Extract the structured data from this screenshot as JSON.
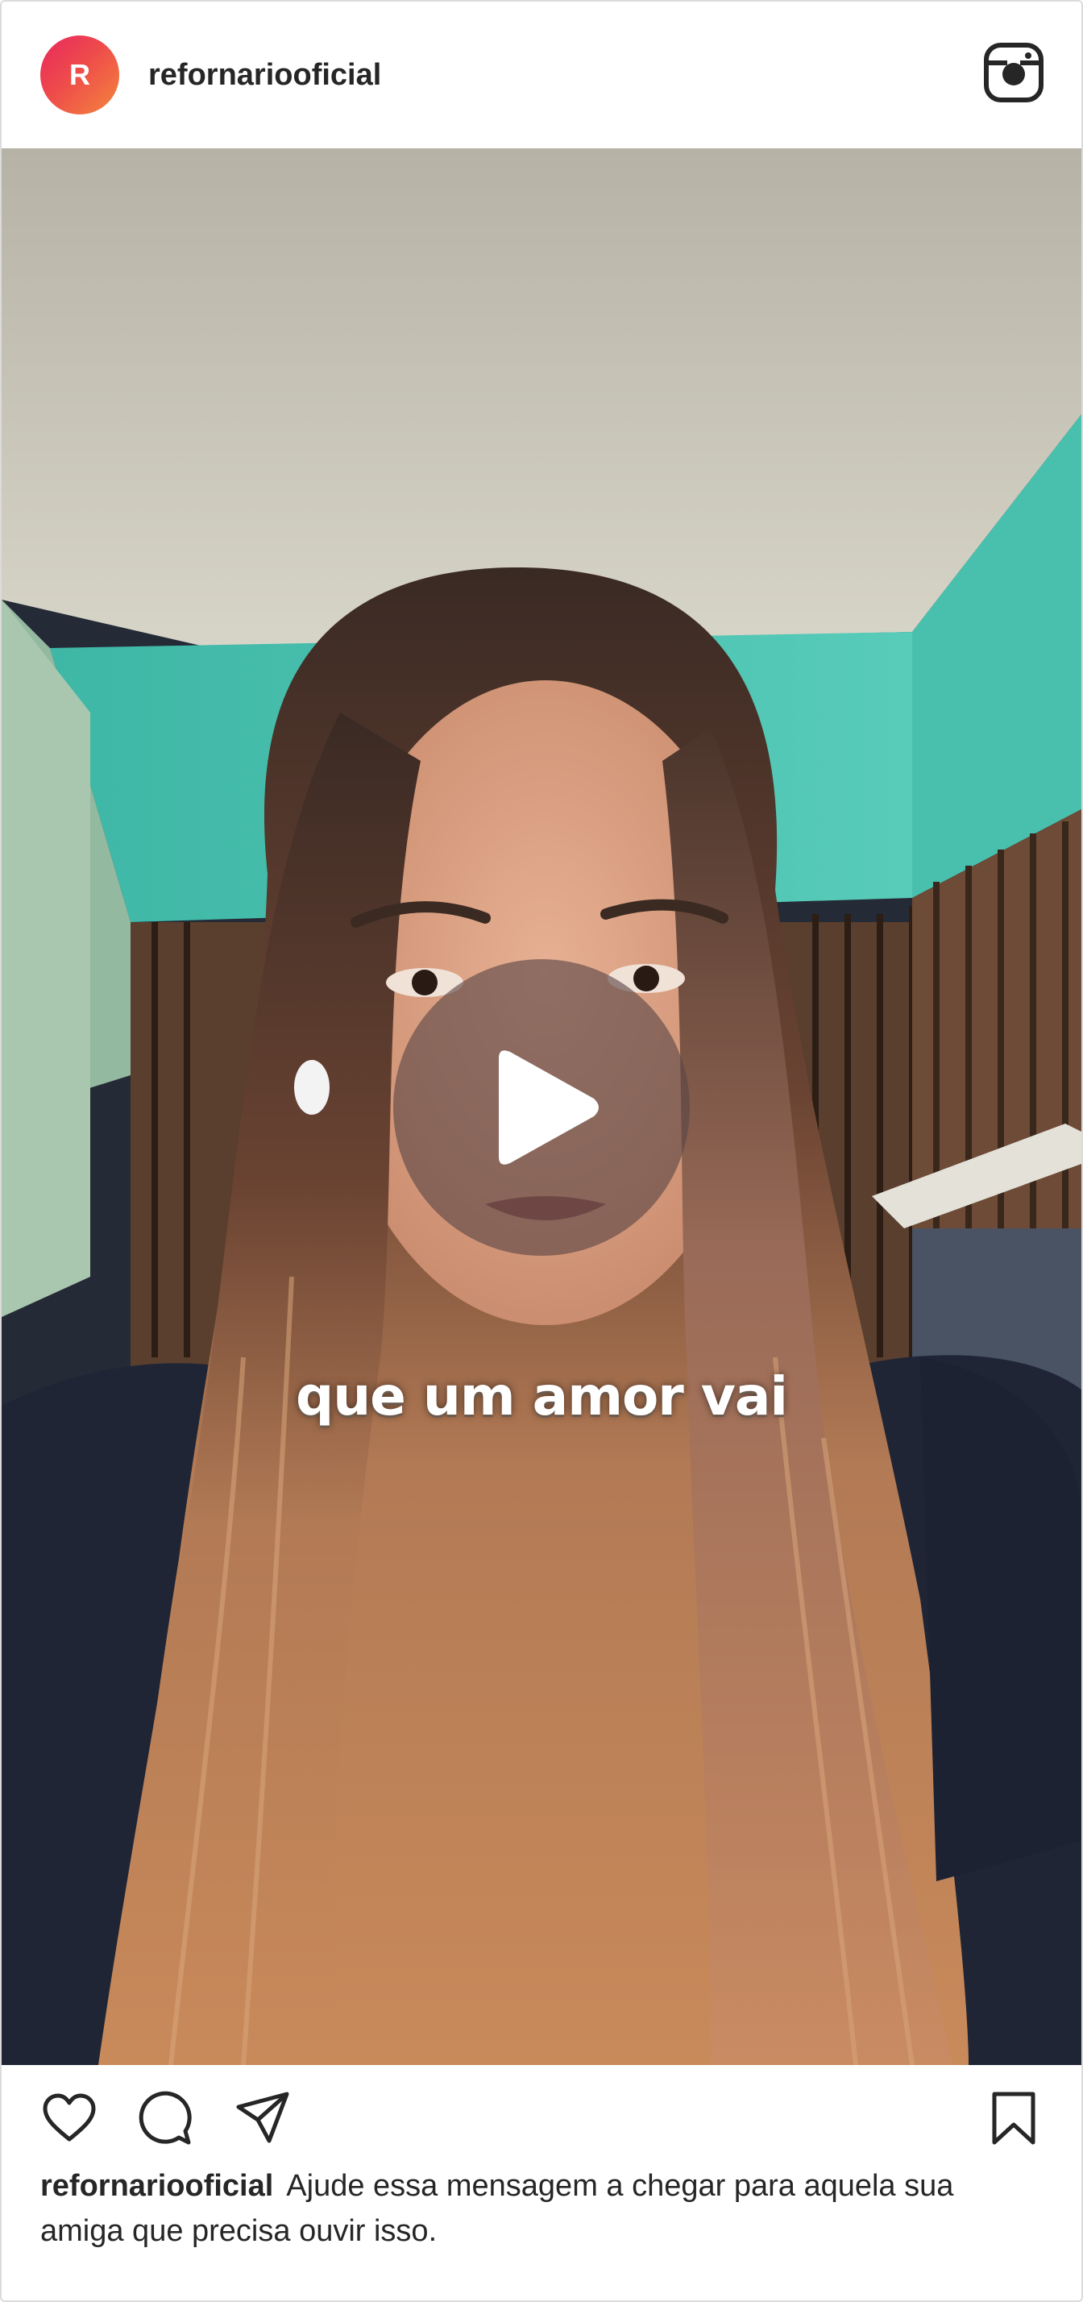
{
  "header": {
    "avatar_letter": "R",
    "username": "refornariooficial",
    "logo_icon": "instagram-icon"
  },
  "media": {
    "subtitle": "que um amor vai",
    "play_icon": "play-icon"
  },
  "actions": {
    "like_icon": "heart-icon",
    "comment_icon": "comment-icon",
    "share_icon": "send-icon",
    "save_icon": "bookmark-icon"
  },
  "caption": {
    "username": "refornariooficial",
    "text": "Ajude essa mensagem a chegar para aquela sua amiga que precisa ouvir isso."
  },
  "colors": {
    "avatar_gradient_start": "#e8285e",
    "avatar_gradient_end": "#f4863c",
    "text": "#262626",
    "border": "#dbdbdb",
    "wall_teal": "#4fc3b2"
  }
}
